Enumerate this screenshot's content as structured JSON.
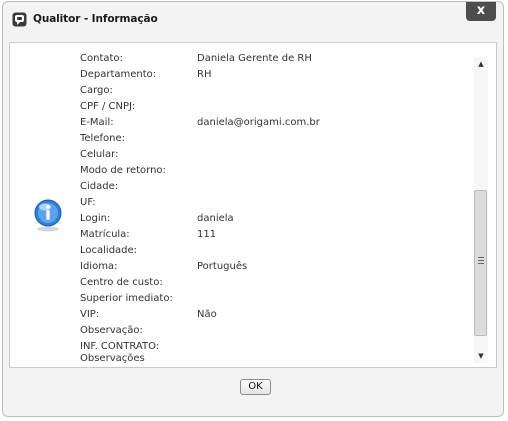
{
  "window": {
    "title": "Qualitor - Informação",
    "close_label": "x"
  },
  "fields": [
    {
      "label": "Contato:",
      "value": "Daniela Gerente de RH"
    },
    {
      "label": "Departamento:",
      "value": "RH"
    },
    {
      "label": "Cargo:",
      "value": ""
    },
    {
      "label": "CPF / CNPJ:",
      "value": ""
    },
    {
      "label": "E-Mail:",
      "value": "daniela@origami.com.br"
    },
    {
      "label": "Telefone:",
      "value": ""
    },
    {
      "label": "Celular:",
      "value": ""
    },
    {
      "label": "Modo de retorno:",
      "value": ""
    },
    {
      "label": "Cidade:",
      "value": ""
    },
    {
      "label": "UF:",
      "value": ""
    },
    {
      "label": "Login:",
      "value": "daniela"
    },
    {
      "label": "Matrícula:",
      "value": "111"
    },
    {
      "label": "Localidade:",
      "value": ""
    },
    {
      "label": "Idioma:",
      "value": "Português"
    },
    {
      "label": "Centro de custo:",
      "value": ""
    },
    {
      "label": "Superior imediato:",
      "value": ""
    },
    {
      "label": "VIP:",
      "value": "Não"
    },
    {
      "label": "Observação:",
      "value": ""
    },
    {
      "label": "INF. CONTRATO:",
      "value": "",
      "sub": "Observações"
    }
  ],
  "buttons": {
    "ok_label": "OK"
  },
  "icons": {
    "title": "qualitor-logo-icon",
    "info": "info-icon"
  },
  "colors": {
    "close_button": "#4d4d4d",
    "info_icon": "#2d7fd6"
  }
}
